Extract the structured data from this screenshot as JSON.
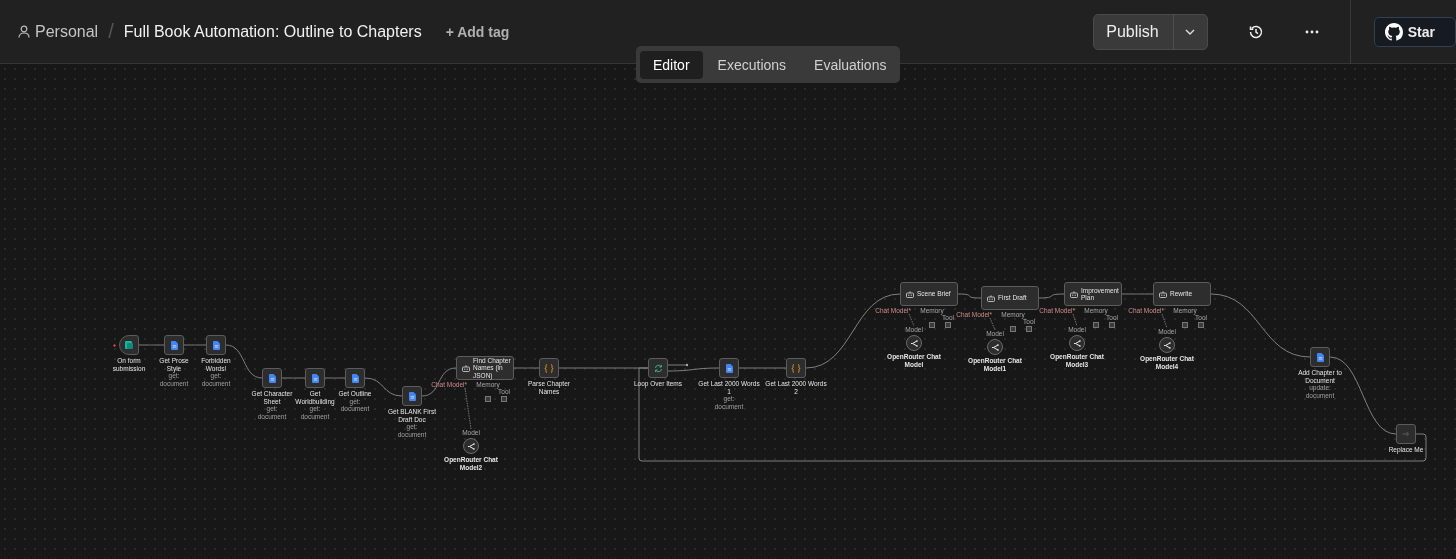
{
  "header": {
    "project": "Personal",
    "separator": "/",
    "workflow_title": "Full Book Automation: Outline to Chapters",
    "add_tag": "+ Add tag",
    "publish_button": "Publish",
    "star_button": "Star"
  },
  "tabs": [
    {
      "label": "Editor",
      "selected": true
    },
    {
      "label": "Executions",
      "selected": false
    },
    {
      "label": "Evaluations",
      "selected": false
    }
  ],
  "nodes": [
    {
      "kind": "trigger",
      "label": "On form submission"
    },
    {
      "kind": "doc",
      "label": "Get Prose Style",
      "subtitle": "get: document"
    },
    {
      "kind": "doc",
      "label": "Forbidden Words!",
      "subtitle": "get: document"
    },
    {
      "kind": "doc",
      "label": "Get Character Sheet",
      "subtitle": "get: document"
    },
    {
      "kind": "doc",
      "label": "Get Worldbuilding",
      "subtitle": "get: document"
    },
    {
      "kind": "doc",
      "label": "Get Outline",
      "subtitle": "get: document"
    },
    {
      "kind": "doc",
      "label": "Get BLANK First Draft Doc",
      "subtitle": "get: document"
    },
    {
      "kind": "agent",
      "label": "Find Chapter Names (in JSON)",
      "ports": [
        "Chat Model*",
        "Memory",
        "Tool"
      ],
      "model": {
        "label": "OpenRouter Chat Model2",
        "port_label": "Model"
      }
    },
    {
      "kind": "code",
      "label": "Parse Chapter Names"
    },
    {
      "kind": "loop",
      "label": "Loop Over Items"
    },
    {
      "kind": "doc",
      "label": "Get Last 2000 Words 1",
      "subtitle": "get: document"
    },
    {
      "kind": "code",
      "label": "Get Last 2000 Words 2"
    },
    {
      "kind": "agent",
      "label": "Scene Brief",
      "ports": [
        "Chat Model*",
        "Memory",
        "Tool"
      ],
      "model": {
        "label": "OpenRouter Chat Model",
        "port_label": "Model"
      }
    },
    {
      "kind": "agent",
      "label": "First Draft",
      "ports": [
        "Chat Model*",
        "Memory",
        "Tool"
      ],
      "model": {
        "label": "OpenRouter Chat Model1",
        "port_label": "Model"
      }
    },
    {
      "kind": "agent",
      "label": "Improvement Plan",
      "ports": [
        "Chat Model*",
        "Memory",
        "Tool"
      ],
      "model": {
        "label": "OpenRouter Chat Model3",
        "port_label": "Model"
      }
    },
    {
      "kind": "agent",
      "label": "Rewrite",
      "ports": [
        "Chat Model*",
        "Memory",
        "Tool"
      ],
      "model": {
        "label": "OpenRouter Chat Model4",
        "port_label": "Model"
      }
    },
    {
      "kind": "doc",
      "label": "Add Chapter to Document",
      "subtitle": "update: document"
    },
    {
      "kind": "noop",
      "label": "Replace Me"
    }
  ]
}
